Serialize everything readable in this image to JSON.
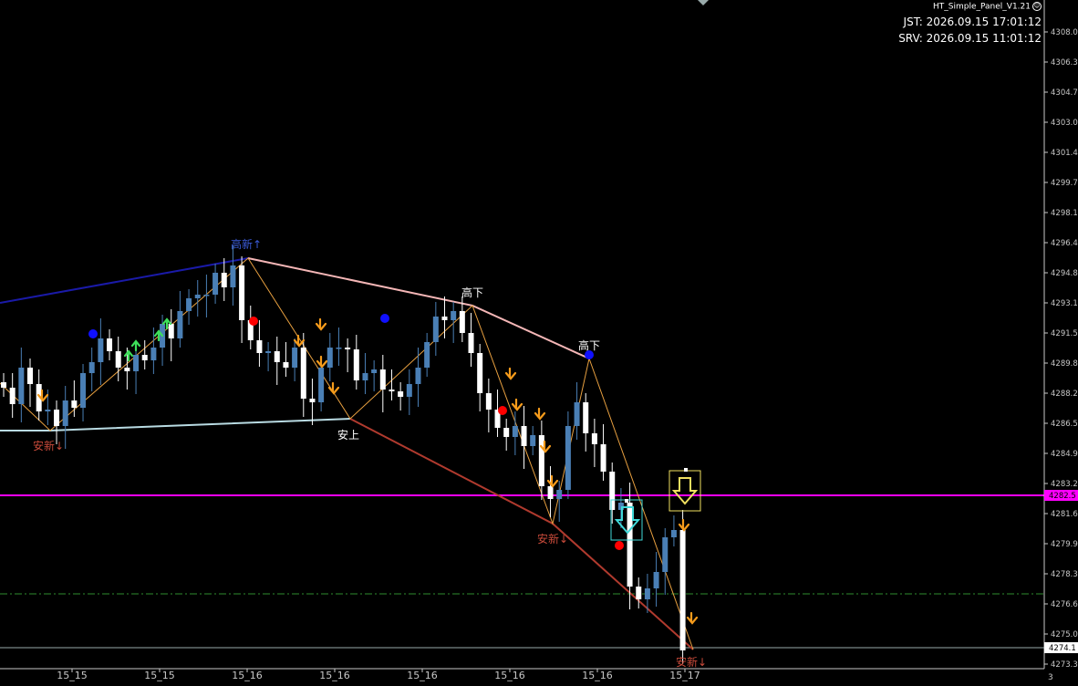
{
  "panel": {
    "title": "HT_Simple_Panel_V1.21",
    "jst": "JST: 2026.09.15 17:01:12",
    "srv": "SRV: 2026.09.15 11:01:12"
  },
  "price_axis": {
    "labels": [
      "4308.00",
      "4306.35",
      "4304.70",
      "4303.05",
      "4301.40",
      "4299.75",
      "4298.10",
      "4296.45",
      "4294.80",
      "4293.15",
      "4291.50",
      "4289.85",
      "4288.20",
      "4286.55",
      "4284.90",
      "4283.25",
      "4281.60",
      "4279.95",
      "4278.30",
      "4276.65",
      "4275.00",
      "4273.35"
    ],
    "current_price_tag": "4282.5",
    "last_price_tag": "4274.1"
  },
  "time_axis": {
    "labels": [
      "15_15",
      "15_15",
      "15_16",
      "15_16",
      "15_16",
      "15_16",
      "15_16",
      "15_17"
    ],
    "right_number": "3"
  },
  "annotations": {
    "high_new": "高新↑",
    "high_down_1": "高下",
    "high_down_2": "高下",
    "low_new_1": "安新↓",
    "low_up": "安上",
    "low_new_2": "安新↓",
    "low_new_3": "安新↓"
  },
  "chart_data": {
    "type": "candlestick",
    "ylim": [
      4273.35,
      4309.0
    ],
    "series": [
      {
        "name": "close",
        "values": [
          4288.5,
          4287.6,
          4289.6,
          4288.7,
          4287.2,
          4287.3,
          4286.4,
          4287.8,
          4287.4,
          4289.3,
          4289.9,
          4291.2,
          4290.5,
          4289.6,
          4289.4,
          4290.3,
          4290.0,
          4290.7,
          4292.0,
          4291.2,
          4292.7,
          4293.4,
          4293.6,
          4293.6,
          4294.8,
          4294.0,
          4295.2,
          4292.2,
          4291.1,
          4290.4,
          4290.5,
          4289.9,
          4289.6,
          4290.7,
          4287.9,
          4287.7,
          4289.6,
          4290.7,
          4290.7,
          4290.6,
          4288.9,
          4289.3,
          4289.5,
          4288.4,
          4288.3,
          4288.0,
          4288.7,
          4289.6,
          4291.0,
          4292.4,
          4292.2,
          4292.7,
          4291.5,
          4290.4,
          4288.2,
          4287.3,
          4286.3,
          4285.8,
          4286.4,
          4285.3,
          4285.9,
          4283.1,
          4282.4,
          4282.9,
          4286.4,
          4287.7,
          4286.0,
          4285.4,
          4283.9,
          4281.8,
          4282.2,
          4277.6,
          4276.9,
          4277.5,
          4278.4,
          4280.3,
          4280.7,
          4274.1
        ]
      }
    ],
    "colors": {
      "bull": "#4a7fb5",
      "bear": "#ffffff",
      "hline_magenta": "#ff00ff",
      "hline_green": "#2e8b2e",
      "trend_blue": "#1a1aa8",
      "trend_pink": "#f4b6b6",
      "trend_light": "#b9dbe3",
      "trend_red": "#b03a2e",
      "zigzag": "#e8a040",
      "arrow_orange": "#f59b1b",
      "arrow_green": "#3ee05a",
      "dot_red": "#ff0000",
      "dot_blue": "#1010ff",
      "box_yellow": "#f0e060",
      "box_cyan": "#40d8d8"
    }
  }
}
